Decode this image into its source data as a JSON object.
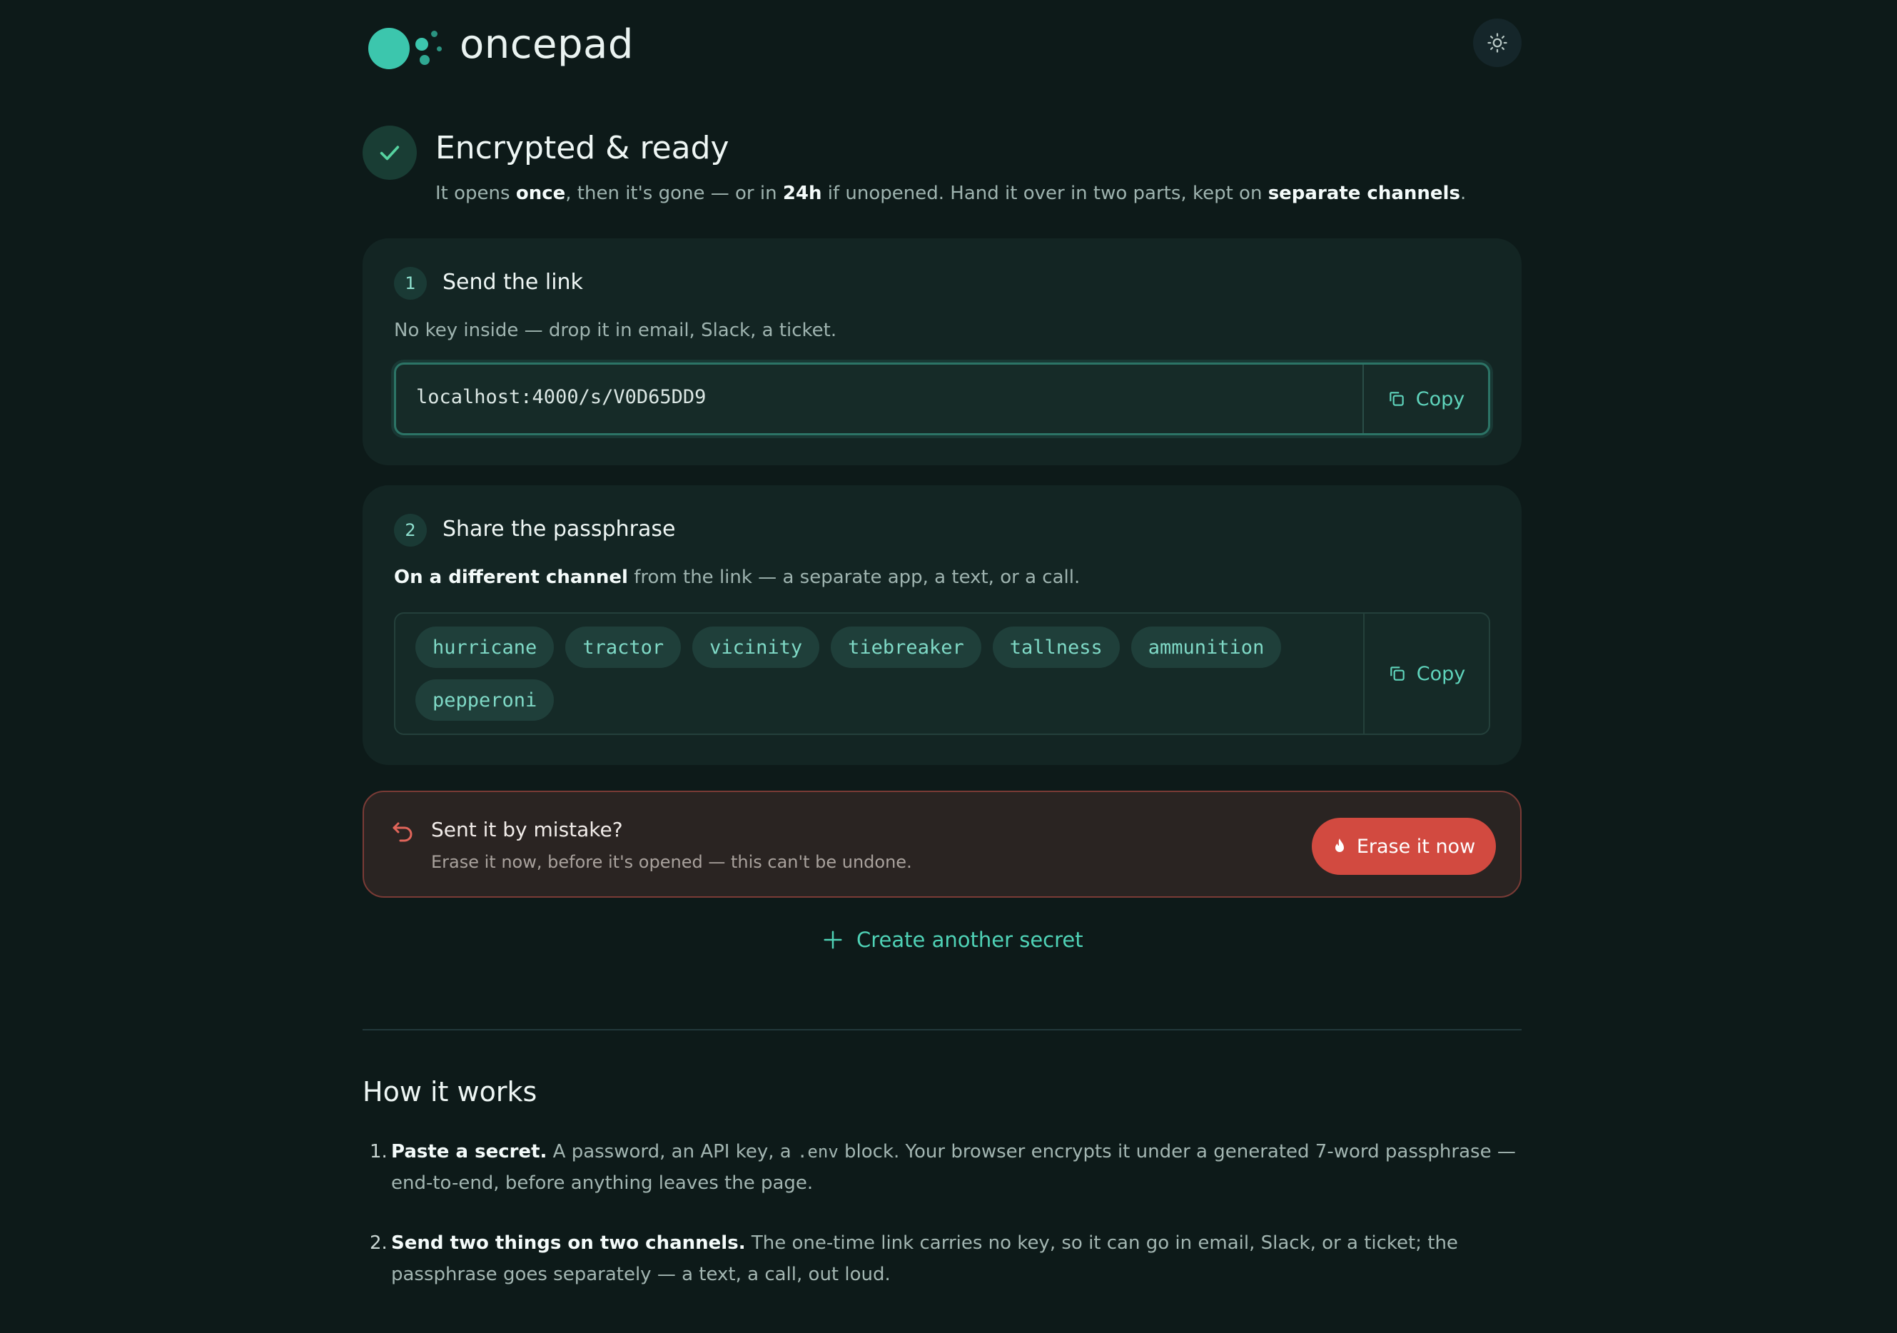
{
  "app": {
    "name": "oncepad"
  },
  "status": {
    "title": "Encrypted & ready",
    "desc_1": "It opens ",
    "desc_once": "once",
    "desc_2": ", then it's gone — or in ",
    "desc_24h": "24h",
    "desc_3": " if unopened. Hand it over in two parts, kept on ",
    "desc_channels": "separate channels",
    "desc_4": "."
  },
  "step1": {
    "num": "1",
    "title": "Send the link",
    "desc": "No key inside — drop it in email, Slack, a ticket.",
    "link": "localhost:4000/s/V0D65DD9",
    "copy_label": "Copy"
  },
  "step2": {
    "num": "2",
    "title": "Share the passphrase",
    "desc_bold": "On a different channel",
    "desc_rest": " from the link — a separate app, a text, or a call.",
    "words": [
      "hurricane",
      "tractor",
      "vicinity",
      "tiebreaker",
      "tallness",
      "ammunition",
      "pepperoni"
    ],
    "copy_label": "Copy"
  },
  "mistake": {
    "title": "Sent it by mistake?",
    "desc": "Erase it now, before it's opened — this can't be undone.",
    "erase_label": "Erase it now"
  },
  "create_another_label": "Create another secret",
  "how": {
    "title": "How it works",
    "items": [
      {
        "num": "1.",
        "bold": "Paste a secret.",
        "text_a": " A password, an API key, a ",
        "code": ".env",
        "text_b": " block. Your browser encrypts it under a generated 7-word passphrase — end-to-end, before anything leaves the page."
      },
      {
        "num": "2.",
        "bold": "Send two things on two channels.",
        "text_a": " The one-time link carries no key, so it can go in email, Slack, or a ticket; the passphrase goes separately — a text, a call, out loud."
      }
    ]
  },
  "colors": {
    "background": "#0d1a19",
    "accent": "#3cc6ad",
    "danger": "#d24a40"
  },
  "icons": {
    "theme": "sun-icon",
    "status": "check-icon",
    "copy": "copy-icon",
    "mistake": "undo-arrow-icon",
    "erase": "flame-icon",
    "create": "plus-icon"
  }
}
